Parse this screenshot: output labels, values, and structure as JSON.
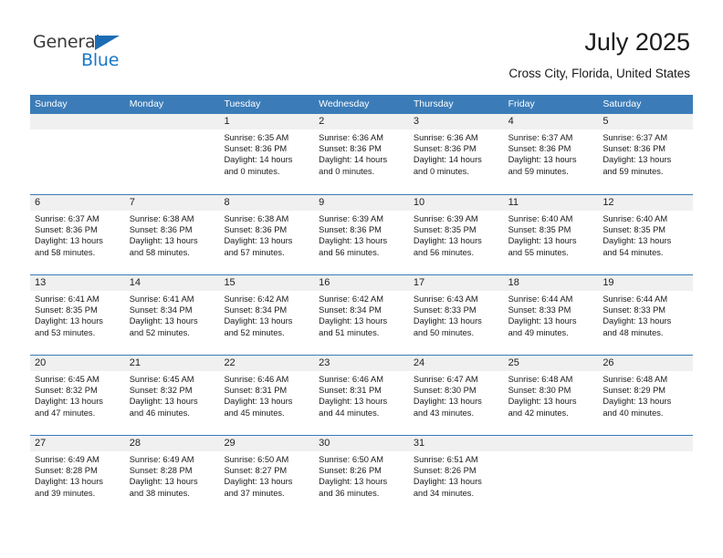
{
  "brand": {
    "name_top": "General",
    "name_bottom": "Blue",
    "triangle_color": "#1b6cb5",
    "blue_color": "#1878c8"
  },
  "header": {
    "title": "July 2025",
    "subtitle": "Cross City, Florida, United States"
  },
  "colors": {
    "header_bar": "#3b7cb8",
    "date_band": "#f0f0f0",
    "row_divider": "#3b7cb8",
    "text": "#1a1a1a"
  },
  "weekdays": [
    "Sunday",
    "Monday",
    "Tuesday",
    "Wednesday",
    "Thursday",
    "Friday",
    "Saturday"
  ],
  "weeks": [
    [
      {
        "day": "",
        "lines": []
      },
      {
        "day": "",
        "lines": []
      },
      {
        "day": "1",
        "lines": [
          "Sunrise: 6:35 AM",
          "Sunset: 8:36 PM",
          "Daylight: 14 hours",
          "and 0 minutes."
        ]
      },
      {
        "day": "2",
        "lines": [
          "Sunrise: 6:36 AM",
          "Sunset: 8:36 PM",
          "Daylight: 14 hours",
          "and 0 minutes."
        ]
      },
      {
        "day": "3",
        "lines": [
          "Sunrise: 6:36 AM",
          "Sunset: 8:36 PM",
          "Daylight: 14 hours",
          "and 0 minutes."
        ]
      },
      {
        "day": "4",
        "lines": [
          "Sunrise: 6:37 AM",
          "Sunset: 8:36 PM",
          "Daylight: 13 hours",
          "and 59 minutes."
        ]
      },
      {
        "day": "5",
        "lines": [
          "Sunrise: 6:37 AM",
          "Sunset: 8:36 PM",
          "Daylight: 13 hours",
          "and 59 minutes."
        ]
      }
    ],
    [
      {
        "day": "6",
        "lines": [
          "Sunrise: 6:37 AM",
          "Sunset: 8:36 PM",
          "Daylight: 13 hours",
          "and 58 minutes."
        ]
      },
      {
        "day": "7",
        "lines": [
          "Sunrise: 6:38 AM",
          "Sunset: 8:36 PM",
          "Daylight: 13 hours",
          "and 58 minutes."
        ]
      },
      {
        "day": "8",
        "lines": [
          "Sunrise: 6:38 AM",
          "Sunset: 8:36 PM",
          "Daylight: 13 hours",
          "and 57 minutes."
        ]
      },
      {
        "day": "9",
        "lines": [
          "Sunrise: 6:39 AM",
          "Sunset: 8:36 PM",
          "Daylight: 13 hours",
          "and 56 minutes."
        ]
      },
      {
        "day": "10",
        "lines": [
          "Sunrise: 6:39 AM",
          "Sunset: 8:35 PM",
          "Daylight: 13 hours",
          "and 56 minutes."
        ]
      },
      {
        "day": "11",
        "lines": [
          "Sunrise: 6:40 AM",
          "Sunset: 8:35 PM",
          "Daylight: 13 hours",
          "and 55 minutes."
        ]
      },
      {
        "day": "12",
        "lines": [
          "Sunrise: 6:40 AM",
          "Sunset: 8:35 PM",
          "Daylight: 13 hours",
          "and 54 minutes."
        ]
      }
    ],
    [
      {
        "day": "13",
        "lines": [
          "Sunrise: 6:41 AM",
          "Sunset: 8:35 PM",
          "Daylight: 13 hours",
          "and 53 minutes."
        ]
      },
      {
        "day": "14",
        "lines": [
          "Sunrise: 6:41 AM",
          "Sunset: 8:34 PM",
          "Daylight: 13 hours",
          "and 52 minutes."
        ]
      },
      {
        "day": "15",
        "lines": [
          "Sunrise: 6:42 AM",
          "Sunset: 8:34 PM",
          "Daylight: 13 hours",
          "and 52 minutes."
        ]
      },
      {
        "day": "16",
        "lines": [
          "Sunrise: 6:42 AM",
          "Sunset: 8:34 PM",
          "Daylight: 13 hours",
          "and 51 minutes."
        ]
      },
      {
        "day": "17",
        "lines": [
          "Sunrise: 6:43 AM",
          "Sunset: 8:33 PM",
          "Daylight: 13 hours",
          "and 50 minutes."
        ]
      },
      {
        "day": "18",
        "lines": [
          "Sunrise: 6:44 AM",
          "Sunset: 8:33 PM",
          "Daylight: 13 hours",
          "and 49 minutes."
        ]
      },
      {
        "day": "19",
        "lines": [
          "Sunrise: 6:44 AM",
          "Sunset: 8:33 PM",
          "Daylight: 13 hours",
          "and 48 minutes."
        ]
      }
    ],
    [
      {
        "day": "20",
        "lines": [
          "Sunrise: 6:45 AM",
          "Sunset: 8:32 PM",
          "Daylight: 13 hours",
          "and 47 minutes."
        ]
      },
      {
        "day": "21",
        "lines": [
          "Sunrise: 6:45 AM",
          "Sunset: 8:32 PM",
          "Daylight: 13 hours",
          "and 46 minutes."
        ]
      },
      {
        "day": "22",
        "lines": [
          "Sunrise: 6:46 AM",
          "Sunset: 8:31 PM",
          "Daylight: 13 hours",
          "and 45 minutes."
        ]
      },
      {
        "day": "23",
        "lines": [
          "Sunrise: 6:46 AM",
          "Sunset: 8:31 PM",
          "Daylight: 13 hours",
          "and 44 minutes."
        ]
      },
      {
        "day": "24",
        "lines": [
          "Sunrise: 6:47 AM",
          "Sunset: 8:30 PM",
          "Daylight: 13 hours",
          "and 43 minutes."
        ]
      },
      {
        "day": "25",
        "lines": [
          "Sunrise: 6:48 AM",
          "Sunset: 8:30 PM",
          "Daylight: 13 hours",
          "and 42 minutes."
        ]
      },
      {
        "day": "26",
        "lines": [
          "Sunrise: 6:48 AM",
          "Sunset: 8:29 PM",
          "Daylight: 13 hours",
          "and 40 minutes."
        ]
      }
    ],
    [
      {
        "day": "27",
        "lines": [
          "Sunrise: 6:49 AM",
          "Sunset: 8:28 PM",
          "Daylight: 13 hours",
          "and 39 minutes."
        ]
      },
      {
        "day": "28",
        "lines": [
          "Sunrise: 6:49 AM",
          "Sunset: 8:28 PM",
          "Daylight: 13 hours",
          "and 38 minutes."
        ]
      },
      {
        "day": "29",
        "lines": [
          "Sunrise: 6:50 AM",
          "Sunset: 8:27 PM",
          "Daylight: 13 hours",
          "and 37 minutes."
        ]
      },
      {
        "day": "30",
        "lines": [
          "Sunrise: 6:50 AM",
          "Sunset: 8:26 PM",
          "Daylight: 13 hours",
          "and 36 minutes."
        ]
      },
      {
        "day": "31",
        "lines": [
          "Sunrise: 6:51 AM",
          "Sunset: 8:26 PM",
          "Daylight: 13 hours",
          "and 34 minutes."
        ]
      },
      {
        "day": "",
        "lines": []
      },
      {
        "day": "",
        "lines": []
      }
    ]
  ]
}
